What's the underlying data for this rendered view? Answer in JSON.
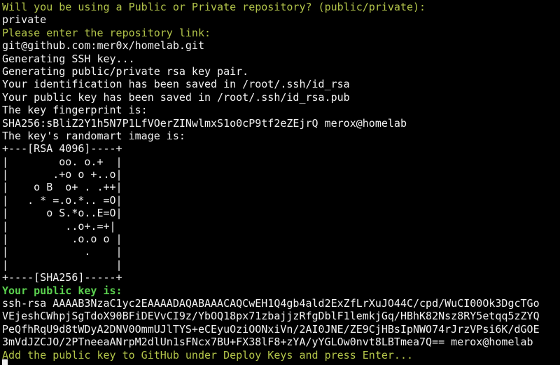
{
  "terminal": {
    "prompt_visibility": "Will you be using a Public or Private repository? (public/private):",
    "answer_visibility": "private",
    "prompt_repo_link": "Please enter the repository link:",
    "answer_repo_link": "git@github.com:mer0x/homelab.git",
    "msg_generating_ssh": "Generating SSH key...",
    "msg_generating_pair": "Generating public/private rsa key pair.",
    "msg_identification_saved": "Your identification has been saved in /root/.ssh/id_rsa",
    "msg_pubkey_saved": "Your public key has been saved in /root/.ssh/id_rsa.pub",
    "msg_fingerprint_label": "The key fingerprint is:",
    "fingerprint": "SHA256:sBliZ2Y1h5N7P1LfVOerZINwlmxS1o0cP9tf2eZEjrQ merox@homelab",
    "msg_randomart_label": "The key's randomart image is:",
    "randomart": [
      "+---[RSA 4096]----+",
      "|        oo. o.+  |",
      "|       .+o o +..o|",
      "|    o B  o+ . .++|",
      "|   . * =.o.*.. =O|",
      "|      o S.*o..E=O|",
      "|         ..o+.=+|",
      "|          .o.o o |",
      "|            .    |",
      "|                 |",
      "+----[SHA256]-----+"
    ],
    "prompt_public_key": "Your public key is:",
    "public_key_lines": [
      "ssh-rsa AAAAB3NzaC1yc2EAAAADAQABAAACAQCwEH1Q4gb4ald2ExZfLrXuJO44C/cpd/WuCI00Ok3DgcTGo",
      "VEjeshCWhpjSgTdoX90BFiDEVvCI9z/YbOQ18px71zbajjzRfgDblF1lemkjGq/HBhK82Nsz8RY5etqq5zZYQ",
      "PeQfhRqU9d8tWDyA2DNV0OmmUJlTYS+eCEyuOziOONxiVn/2AI0JNE/ZE9CjHBsIpNWO74rJrzVPsi6K/dGOE",
      "3mVdJZCJO/2PTneeaANrpM2dlUn1sFNcx7BU+FX38lF8+zYA/yYGLOw0nvt8LBTmea7Q== merox@homelab"
    ],
    "prompt_deploy_keys": "Add the public key to GitHub under Deploy Keys and press Enter..."
  },
  "colors": {
    "background": "#000000",
    "text": "#f2f2f2",
    "prompt_olive": "#b3c54a",
    "prompt_green": "#5bd14f"
  }
}
